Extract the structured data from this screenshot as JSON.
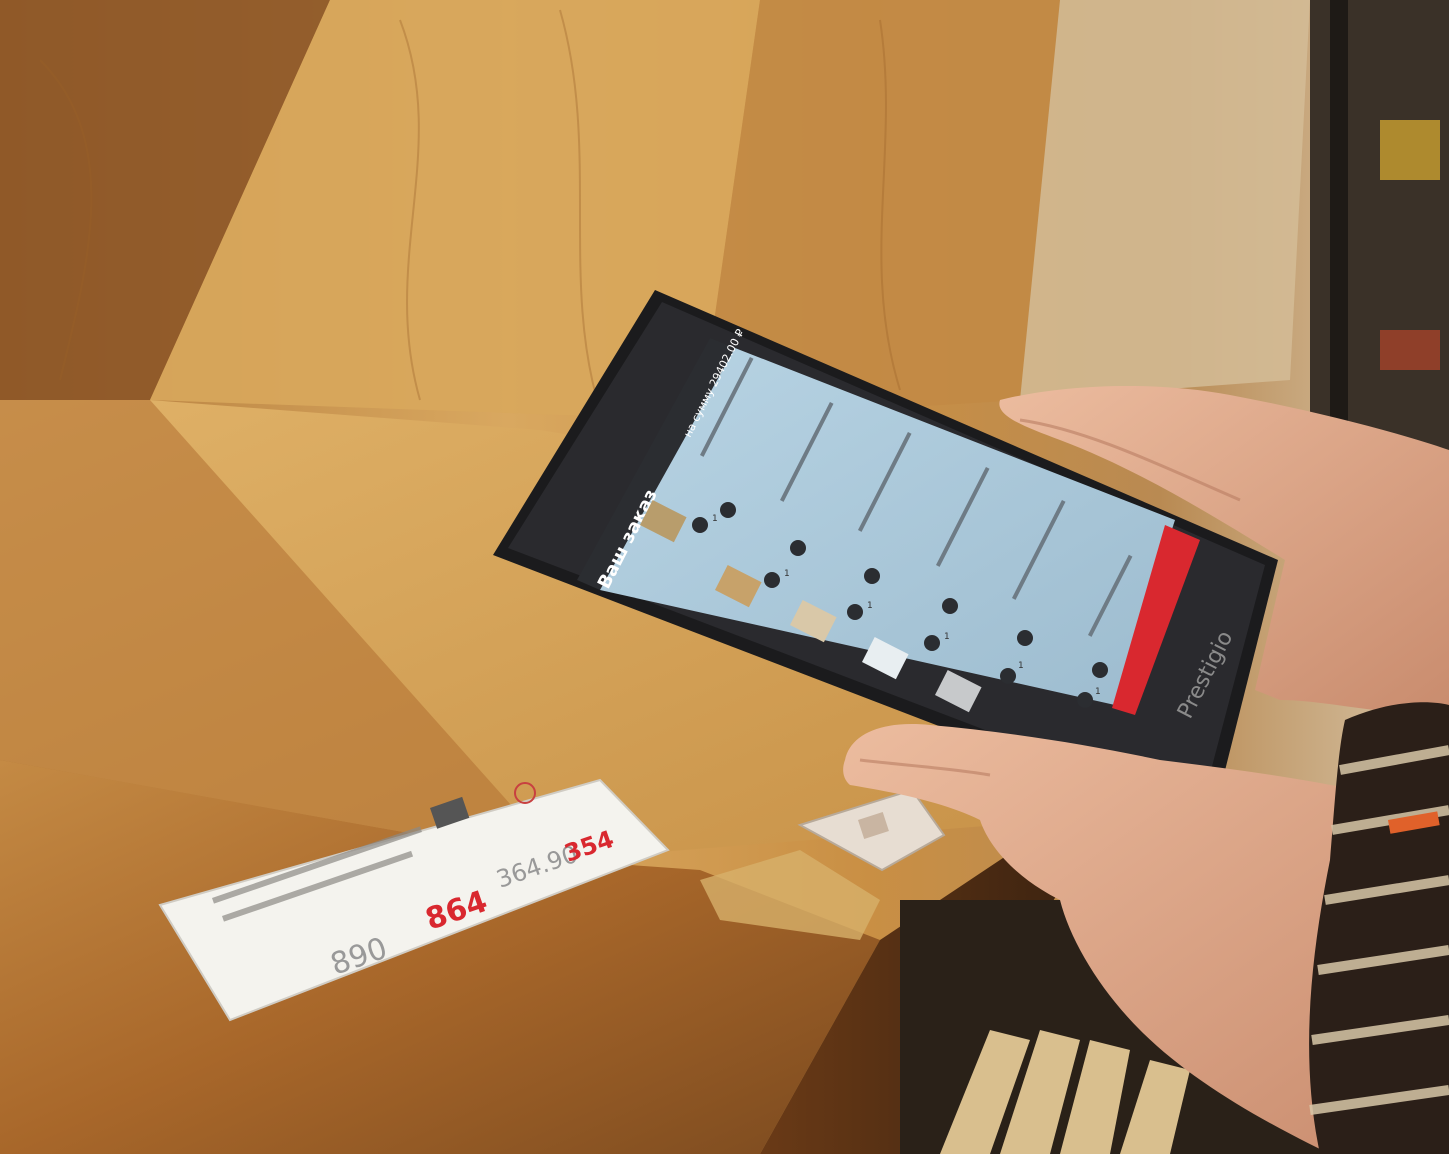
{
  "tablet": {
    "header_title": "Ваш заказ",
    "header_total": "на сумму 29402.00 ₽",
    "brand": "Prestigio",
    "order_items": [
      {
        "qty": "1"
      },
      {
        "qty": "1"
      },
      {
        "qty": "1"
      },
      {
        "qty": "1"
      },
      {
        "qty": "1"
      },
      {
        "qty": "1"
      }
    ]
  },
  "price_tag": {
    "prices": [
      "890",
      "864",
      "364.90",
      "354"
    ]
  },
  "colors": {
    "wood_light": "#d3a055",
    "wood_dark": "#7a4a1e",
    "screen": "#a9c7d9",
    "accent_red": "#d9282f",
    "skin": "#e2a98c"
  }
}
